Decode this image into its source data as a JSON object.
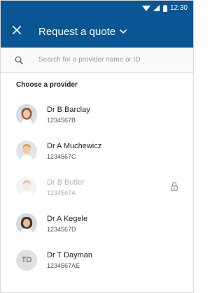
{
  "colors": {
    "header": "#0a5593",
    "disabled_text": "#b0b0b0"
  },
  "status_bar": {
    "time": "12:30",
    "icons": [
      "wifi-icon",
      "signal-icon",
      "battery-icon"
    ]
  },
  "toolbar": {
    "close_icon": "close-icon",
    "title": "Request a quote",
    "title_icon": "chevron-down-icon"
  },
  "search": {
    "placeholder": "Search for a provider name or ID",
    "value": "",
    "icon": "search-icon"
  },
  "section_title": "Choose a provider",
  "providers": [
    {
      "name": "Dr B Barclay",
      "id": "1234567B",
      "avatar": "photo-female",
      "disabled": false
    },
    {
      "name": "Dr A Muchewicz",
      "id": "1234567C",
      "avatar": "photo-male",
      "disabled": false
    },
    {
      "name": "Dr B Butler",
      "id": "1234567A",
      "avatar": "photo-male-light",
      "disabled": true,
      "status_icon": "lock-icon"
    },
    {
      "name": "Dr A Kegele",
      "id": "1234567D",
      "avatar": "photo-female-dark",
      "disabled": false
    },
    {
      "name": "Dr T Dayman",
      "id": "1234567AE",
      "avatar": "initials",
      "initials": "TD",
      "disabled": false
    }
  ]
}
